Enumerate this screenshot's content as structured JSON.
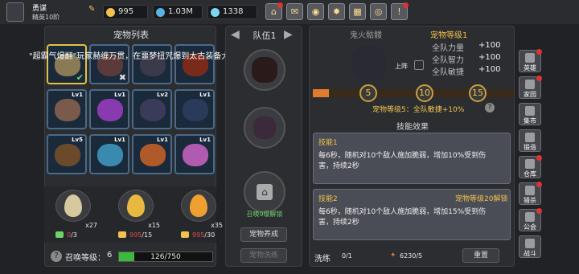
{
  "player": {
    "name": "勇谋",
    "rank": "精英10阶"
  },
  "resources": [
    {
      "name": "coin-icon",
      "value": "995",
      "color": "#f2c14e"
    },
    {
      "name": "gem-icon",
      "value": "1.03M",
      "color": "#57b3e6"
    },
    {
      "name": "diamond-icon",
      "value": "1338",
      "color": "#7fd6f2"
    }
  ],
  "toolbar_icons": [
    "shop-icon",
    "mail-icon",
    "gamepad-icon",
    "settings-icon",
    "gift-icon",
    "wheel-icon",
    "alert-icon"
  ],
  "pet_list": {
    "title": "宠物列表",
    "marquee": "\"超霸气爆翻\"玩家赫缠万贯，在噩梦扭咒爆到太古装备大地之惩戒",
    "pets": [
      {
        "level": "",
        "color": "#8a7a55",
        "border": "#e8c040",
        "state": "check"
      },
      {
        "level": "",
        "color": "#5a3a3a",
        "border": "#4a6a8a",
        "state": "x"
      },
      {
        "level": "",
        "color": "#3a3a4a",
        "border": "#4a6a8a",
        "state": ""
      },
      {
        "level": "",
        "color": "#7a2a1a",
        "border": "#4a6a8a",
        "state": ""
      },
      {
        "level": "Lv1",
        "color": "#7a5a4a",
        "border": "#4a6a8a",
        "state": ""
      },
      {
        "level": "Lv1",
        "color": "#8a3ab0",
        "border": "#4a6a8a",
        "state": ""
      },
      {
        "level": "Lv2",
        "color": "#3a3a5a",
        "border": "#4a6a8a",
        "state": ""
      },
      {
        "level": "Lv1",
        "color": "#2a3a5a",
        "border": "#4a6a8a",
        "state": ""
      },
      {
        "level": "Lv5",
        "color": "#6a4a2a",
        "border": "#4a6a8a",
        "state": ""
      },
      {
        "level": "Lv1",
        "color": "#3a8ab0",
        "border": "#4a6a8a",
        "state": ""
      },
      {
        "level": "Lv1",
        "color": "#b05a2a",
        "border": "#4a6a8a",
        "state": ""
      },
      {
        "level": "Lv1",
        "color": "#b05ab0",
        "border": "#4a6a8a",
        "state": ""
      }
    ],
    "eggs": [
      {
        "count": "x27",
        "color": "#d8c8a0"
      },
      {
        "count": "x15",
        "color": "#e8b840"
      },
      {
        "count": "x35",
        "color": "#f0a030"
      }
    ],
    "costs": [
      {
        "a": "0",
        "b": "/3"
      },
      {
        "a": "995",
        "b": "/15"
      },
      {
        "a": "995",
        "b": "/30"
      }
    ],
    "summon_label": "召唤等级：",
    "summon_level": "6",
    "summon_progress": "126/750",
    "summon_fraction": 0.168
  },
  "team": {
    "title": "队伍1",
    "unlock_text": "召唤9级解锁",
    "btn_pet_raise": "宠物养成",
    "btn_pet_other": "宠物洗练"
  },
  "detail": {
    "pet_name": "鬼火骷髅",
    "pet_level": "宠物等级1",
    "stats": [
      {
        "label": "全队力量",
        "value": "+100"
      },
      {
        "label": "全队智力",
        "value": "+100"
      },
      {
        "label": "全队敏捷",
        "value": "+100"
      }
    ],
    "deploy_label": "上阵",
    "milestones": [
      "5",
      "10",
      "15"
    ],
    "bonus_text": "宠物等级5：全队敏捷+10%",
    "skill_effect_title": "技能效果",
    "skill1": {
      "title": "技能1",
      "desc": "每6秒，随机对10个敌人施加脆弱，增加10%受到伤害，持续2秒"
    },
    "skill2": {
      "title": "技能2",
      "req": "宠物等级20解锁",
      "desc": "每6秒，随机对10个敌人施加脆弱，增加15%受到伤害，持续2秒"
    },
    "wash_label": "洗练",
    "wash_count": "0/1",
    "wash_cost": "6230/5",
    "reset_label": "重置"
  },
  "side_menu": [
    {
      "icon": "hero-icon",
      "label": "英雄",
      "alert": true
    },
    {
      "icon": "home-icon",
      "label": "家园",
      "alert": true
    },
    {
      "icon": "market-icon",
      "label": "集市",
      "alert": false
    },
    {
      "icon": "forge-icon",
      "label": "锻造",
      "alert": false
    },
    {
      "icon": "storage-icon",
      "label": "仓库",
      "alert": true
    },
    {
      "icon": "hunt-icon",
      "label": "猎杀",
      "alert": true
    },
    {
      "icon": "guild-icon",
      "label": "公会",
      "alert": true
    },
    {
      "icon": "battle-icon",
      "label": "战斗",
      "alert": false
    }
  ]
}
